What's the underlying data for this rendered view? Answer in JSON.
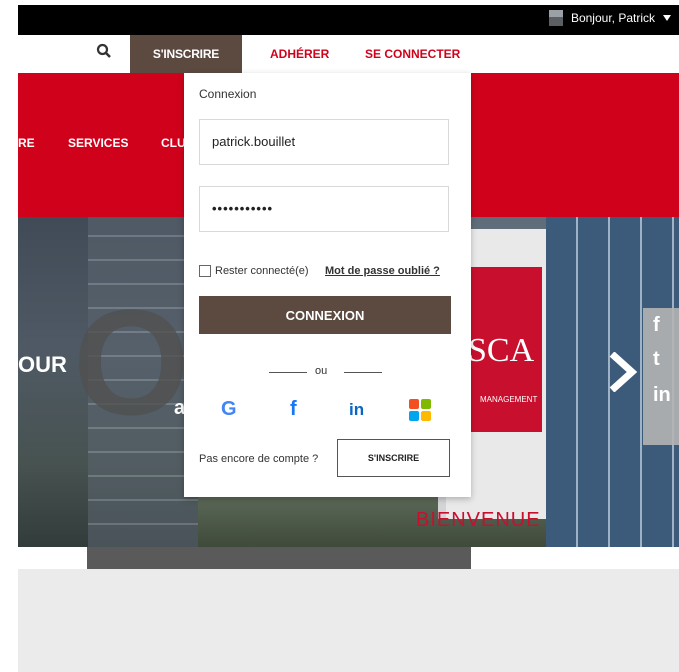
{
  "topbar": {
    "greeting": "Bonjour, Patrick"
  },
  "nav": {
    "signup": "S'INSCRIRE",
    "join": "ADHÉRER",
    "login": "SE CONNECTER"
  },
  "menu": {
    "item_partial": "RE",
    "services": "SERVICES",
    "clubs_partial": "CLU"
  },
  "hero": {
    "text_partial": "OUR",
    "big_letter": "O",
    "letter_a": "a",
    "sign_brand": "SCA",
    "sign_sub": "MANAGEMENT",
    "welcome": "BIENVENUE"
  },
  "login": {
    "title": "Connexion",
    "username": "patrick.bouillet",
    "password_mask": "•••••••••••",
    "remember": "Rester connecté(e)",
    "forgot": "Mot de passe oublié ?",
    "submit": "CONNEXION",
    "or": "ou",
    "social": [
      "G",
      "f",
      "in"
    ],
    "no_account": "Pas encore de compte ?",
    "signup_button": "S'INSCRIRE"
  },
  "social_sidebar": [
    "f",
    "t",
    "in"
  ],
  "colors": {
    "brand_red": "#d0021b",
    "brown": "#5c4a41",
    "google_blue": "#4285f4",
    "facebook_blue": "#1877f2",
    "linkedin_blue": "#0a66c2"
  }
}
